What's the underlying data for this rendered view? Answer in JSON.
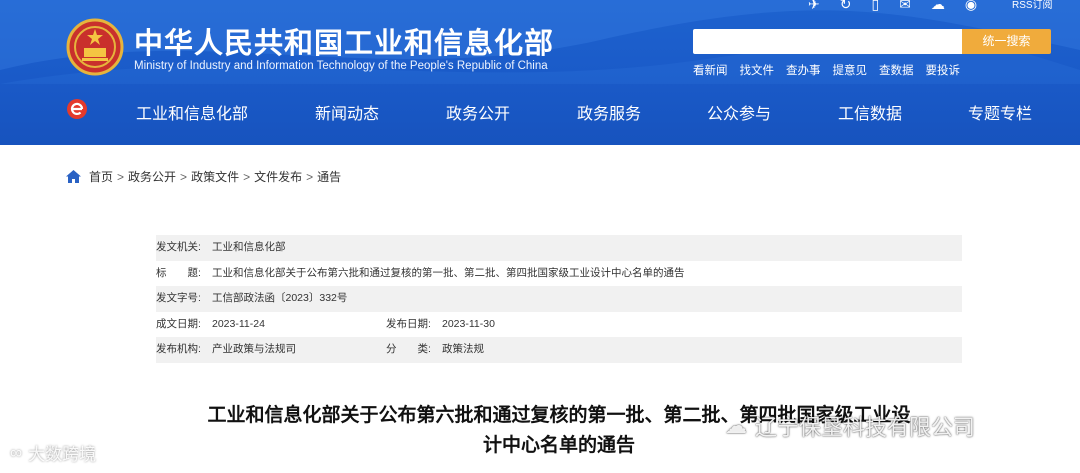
{
  "header": {
    "title_cn": "中华人民共和国工业和信息化部",
    "title_en": "Ministry of Industry and Information Technology of the People's Republic of China",
    "rss_label": "RSS订阅",
    "search_placeholder": "",
    "search_button": "统一搜索",
    "quick_links": [
      "看新闻",
      "找文件",
      "查办事",
      "提意见",
      "查数据",
      "要投诉"
    ],
    "icons": [
      "bird-icon",
      "refresh-icon",
      "mobile-icon",
      "mail-icon",
      "wechat-icon",
      "weibo-icon"
    ]
  },
  "nav": {
    "items": [
      "工业和信息化部",
      "新闻动态",
      "政务公开",
      "政务服务",
      "公众参与",
      "工信数据",
      "专题专栏"
    ]
  },
  "breadcrumb": {
    "items": [
      "首页",
      "政务公开",
      "政策文件",
      "文件发布",
      "通告"
    ],
    "separator": ">"
  },
  "meta": {
    "issuer_label": "发文机关:",
    "issuer": "工业和信息化部",
    "title_label": "标　　题:",
    "title": "工业和信息化部关于公布第六批和通过复核的第一批、第二批、第四批国家级工业设计中心名单的通告",
    "doc_no_label": "发文字号:",
    "doc_no": "工信部政法函〔2023〕332号",
    "created_label": "成文日期:",
    "created": "2023-11-24",
    "published_label": "发布日期:",
    "published": "2023-11-30",
    "org_label": "发布机构:",
    "org": "产业政策与法规司",
    "category_label": "分　　类:",
    "category": "政策法规"
  },
  "article": {
    "title_line1": "工业和信息化部关于公布第六批和通过复核的第一批、第二批、第四批国家级工业设",
    "title_line2": "计中心名单的通告"
  },
  "watermarks": {
    "left": "大数跨境",
    "right": "辽宁保垦科技有限公司"
  },
  "colors": {
    "header_blue": "#1a5ac8",
    "search_button": "#f0ab3c",
    "meta_shade": "#f1f1f1"
  }
}
